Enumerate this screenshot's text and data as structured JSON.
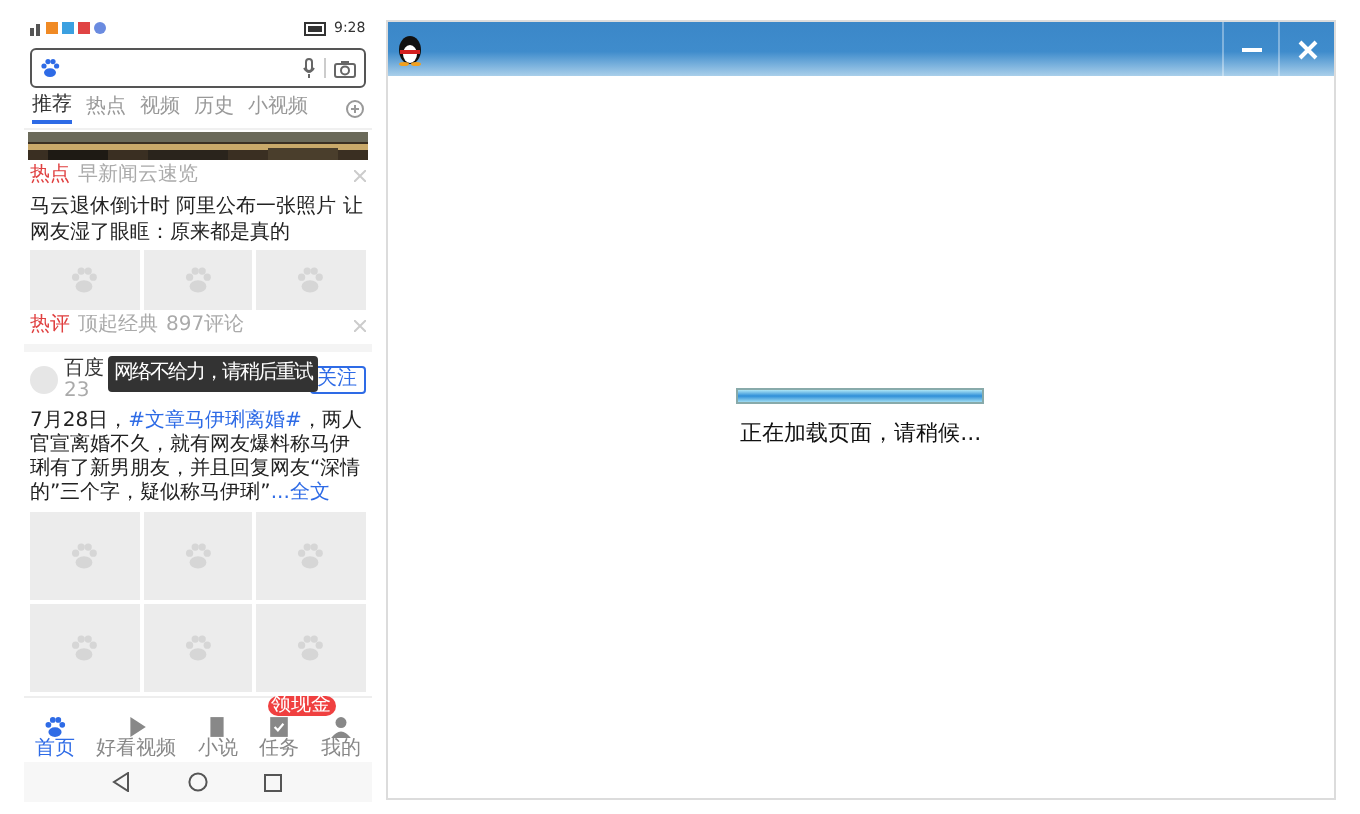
{
  "phone": {
    "status_bar": {
      "time": "9:28"
    },
    "tabs": [
      {
        "label": "推荐",
        "selected": true
      },
      {
        "label": "热点",
        "selected": false
      },
      {
        "label": "视频",
        "selected": false
      },
      {
        "label": "历史",
        "selected": false
      },
      {
        "label": "小视频",
        "selected": false
      }
    ],
    "feed": [
      {
        "kind": "news",
        "tag": "热点",
        "source": "早新闻云速览",
        "headline": "马云退休倒计时 阿里公布一张照片 让网友湿了眼眶：原来都是真的",
        "comment_tag": "热评",
        "comment_source": "顶起经典",
        "comment_count": "897评论"
      },
      {
        "kind": "post",
        "author": "百度",
        "time": "23",
        "follow": "关注",
        "body": [
          {
            "kind": "text",
            "text": "7月28日，"
          },
          {
            "kind": "link",
            "text": "#文章马伊琍离婚#"
          },
          {
            "kind": "text",
            "text": "，两人官宣离婚不久，就有网友爆料称马伊琍有了新男朋友，并且回复网友“深情的”三个字，疑似称马伊琍”"
          },
          {
            "kind": "link",
            "text": "...全文"
          }
        ]
      }
    ],
    "toast": "网络不给力，请稍后重试",
    "bottom_nav": [
      {
        "label": "首页",
        "selected": true
      },
      {
        "label": "好看视频",
        "selected": false
      },
      {
        "label": "小说",
        "selected": false
      },
      {
        "label": "任务",
        "selected": false,
        "badge": "领现金"
      },
      {
        "label": "我的",
        "selected": false
      }
    ]
  },
  "window": {
    "progress": {
      "level": 1
    },
    "message": "正在加载页面，请稍候..."
  }
}
